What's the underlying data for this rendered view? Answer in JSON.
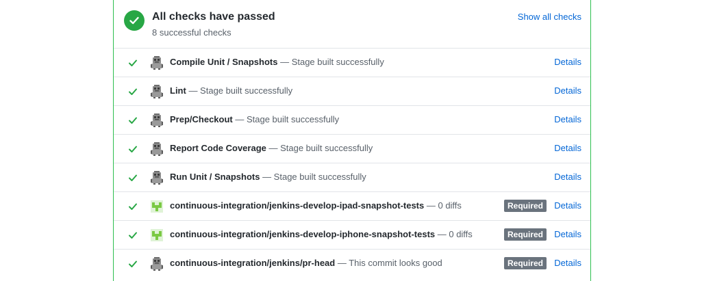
{
  "header": {
    "title": "All checks have passed",
    "subtitle": "8 successful checks",
    "show_all_label": "Show all checks"
  },
  "colors": {
    "success": "#28a745",
    "border_success": "#2cbe4e",
    "link": "#0366d6",
    "badge": "#6a737d"
  },
  "checks": [
    {
      "name": "Compile Unit / Snapshots",
      "description": " — Stage built successfully",
      "avatar": "jenkins-robot-icon",
      "required": false,
      "details_label": "Details"
    },
    {
      "name": "Lint",
      "description": " — Stage built successfully",
      "avatar": "jenkins-robot-icon",
      "required": false,
      "details_label": "Details"
    },
    {
      "name": "Prep/Checkout",
      "description": " — Stage built successfully",
      "avatar": "jenkins-robot-icon",
      "required": false,
      "details_label": "Details"
    },
    {
      "name": "Report Code Coverage",
      "description": " — Stage built successfully",
      "avatar": "jenkins-robot-icon",
      "required": false,
      "details_label": "Details"
    },
    {
      "name": "Run Unit / Snapshots",
      "description": " — Stage built successfully",
      "avatar": "jenkins-robot-icon",
      "required": false,
      "details_label": "Details"
    },
    {
      "name": "continuous-integration/jenkins-develop-ipad-snapshot-tests",
      "description": " — 0 diffs",
      "avatar": "snapshot-app-icon",
      "required": true,
      "required_label": "Required",
      "details_label": "Details"
    },
    {
      "name": "continuous-integration/jenkins-develop-iphone-snapshot-tests",
      "description": " — 0 diffs",
      "avatar": "snapshot-app-icon",
      "required": true,
      "required_label": "Required",
      "details_label": "Details"
    },
    {
      "name": "continuous-integration/jenkins/pr-head",
      "description": " — This commit looks good",
      "avatar": "jenkins-robot-icon",
      "required": true,
      "required_label": "Required",
      "details_label": "Details"
    }
  ]
}
